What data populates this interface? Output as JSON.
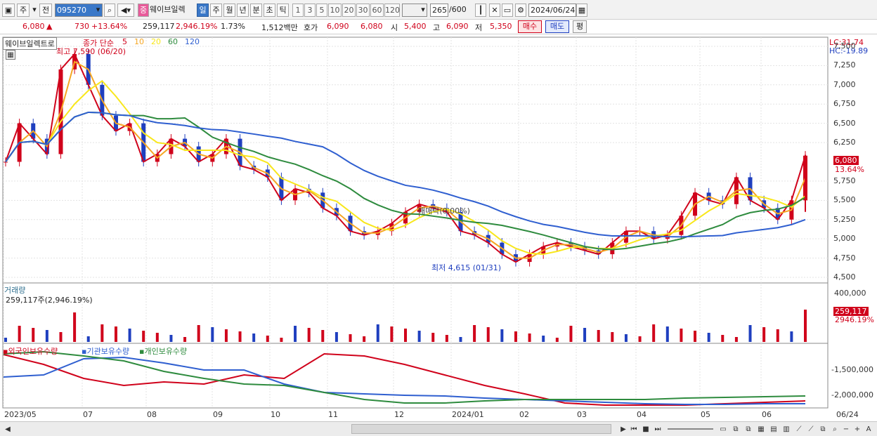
{
  "toolbar": {
    "mode_label": "주",
    "prev_label": "전",
    "code_value": "095270",
    "stock_name": "웨이브일렉",
    "stock_tag": "중",
    "periods": [
      "일",
      "주",
      "월",
      "년",
      "분",
      "초",
      "틱"
    ],
    "selected_period": "일",
    "intervals": [
      "1",
      "3",
      "5",
      "10",
      "20",
      "30",
      "60",
      "120"
    ],
    "count_value": "265",
    "count_total": "/600",
    "date_value": "2024/06/24"
  },
  "quote": {
    "price": "6,080",
    "arrow": "▲",
    "change": "730",
    "change_pct": "+13.64%",
    "volume": "259,117",
    "volume_pct": "2,946.19%",
    "turnover_pct": "1.73%",
    "amount": "1,512백만",
    "ask_label": "호가",
    "ask_value": "6,090",
    "bid_value": "6,080",
    "open_label": "시",
    "open_value": "5,400",
    "high_label": "고",
    "high_value": "6,090",
    "low_label": "저",
    "low_value": "5,350",
    "buy_label": "매수",
    "sell_label": "매도",
    "eval_label": "평"
  },
  "price_pane": {
    "legend_name": "웨이브일렉트로",
    "legend_ma": "종가 단순",
    "ma_periods": [
      "5",
      "10",
      "20",
      "60",
      "120"
    ],
    "ma_colors": [
      "#d0021b",
      "#f5a623",
      "#f8e71c",
      "#2e8b3e",
      "#2f5fd0"
    ],
    "high_note": "최고 7,590 (06/20)",
    "low_note": "최저 4,615 (01/31)",
    "mid_note": "매매락(0,00%)",
    "lc_label": "LC:31.74",
    "hc_label": "HC:-19.89",
    "current_price_tag": "6,080",
    "current_pct_tag": "13.64%",
    "y_ticks": [
      "7,500",
      "7,250",
      "7,000",
      "6,750",
      "6,500",
      "6,250",
      "5,750",
      "5,500",
      "5,250",
      "5,000",
      "4,750",
      "4,500"
    ]
  },
  "volume_pane": {
    "title": "거래량",
    "value_text": "259,117주(2,946.19%)",
    "y_tick": "400,000",
    "current_tag": "259,117",
    "current_pct": "2946.19%"
  },
  "holding_pane": {
    "legend": [
      "외국인보유수량",
      "기관보유수량",
      "개인보유수량"
    ],
    "legend_colors": [
      "#d0021b",
      "#2f5fd0",
      "#2e8b3e"
    ],
    "y_ticks": [
      "-1,500,000",
      "-2,000,000"
    ]
  },
  "x_axis": {
    "labels": [
      "2023/05",
      "07",
      "08",
      "09",
      "10",
      "11",
      "12",
      "2024/01",
      "02",
      "03",
      "04",
      "05",
      "06"
    ],
    "right_label": "06/24"
  },
  "chart_data": {
    "type": "candlestick",
    "title": "웨이브일렉트로",
    "ylim": [
      4500,
      7600
    ],
    "price_series": {
      "name": "종가",
      "values": [
        6000,
        6500,
        6300,
        6100,
        7200,
        7400,
        7000,
        6600,
        6400,
        6500,
        6000,
        6100,
        6300,
        6200,
        6000,
        6100,
        6300,
        5950,
        5900,
        5800,
        5500,
        5650,
        5600,
        5400,
        5300,
        5100,
        5050,
        5100,
        5200,
        5350,
        5450,
        5400,
        5350,
        5100,
        5050,
        4950,
        4800,
        4700,
        4800,
        4900,
        4950,
        4900,
        4850,
        4800,
        4950,
        5100,
        5100,
        5000,
        5050,
        5300,
        5600,
        5500,
        5450,
        5800,
        5500,
        5400,
        5250,
        5500,
        6080
      ]
    },
    "high": 7590,
    "low": 4615
  }
}
